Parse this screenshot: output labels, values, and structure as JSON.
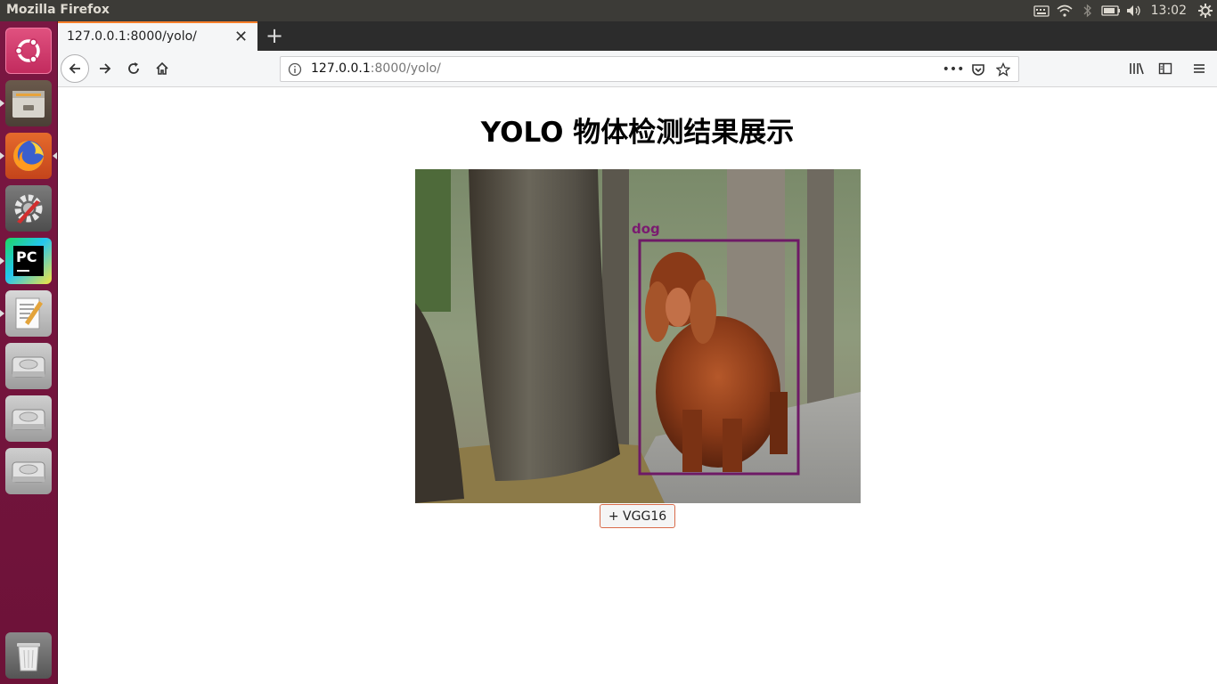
{
  "top_panel": {
    "app_title": "Mozilla Firefox",
    "clock": "13:02"
  },
  "browser": {
    "tab_title": "127.0.0.1:8000/yolo/",
    "url_host": "127.0.0.1",
    "url_rest": ":8000/yolo/"
  },
  "page": {
    "heading": "YOLO 物体检测结果展示",
    "detection": {
      "label": "dog",
      "box_color": "#6e1a66"
    },
    "vgg_button": "+ VGG16"
  },
  "launcher": {
    "items": [
      "ubuntu-dash",
      "files",
      "firefox",
      "system-settings",
      "pycharm",
      "text-editor",
      "drive",
      "drive",
      "drive",
      "trash"
    ]
  },
  "colors": {
    "launcher": "#7a1742",
    "tab_accent": "#ff7f2a",
    "panel": "#3c3b37"
  }
}
